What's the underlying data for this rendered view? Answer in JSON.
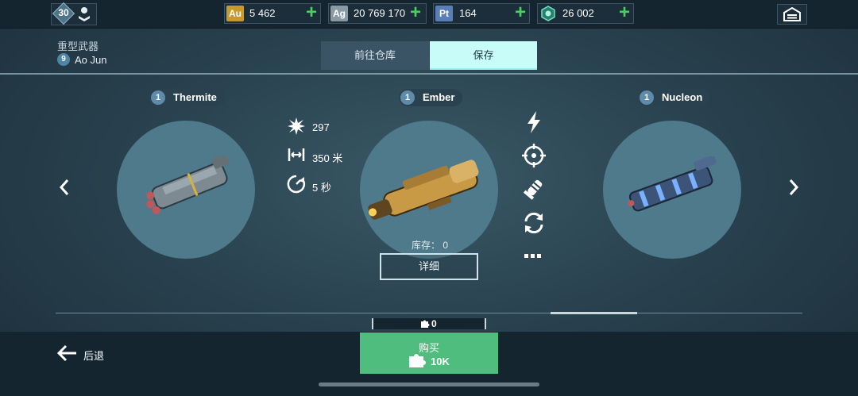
{
  "topbar": {
    "level": "30",
    "resources": [
      {
        "badge": "Au",
        "value": "5 462",
        "badge_color": "#c89a2a"
      },
      {
        "badge": "Ag",
        "value": "20 769 170",
        "badge_color": "#8a9aa4"
      },
      {
        "badge": "Pt",
        "value": "164",
        "badge_color": "#5a7fb8"
      },
      {
        "badge": "",
        "value": "26 002",
        "badge_color": "#3aa68a"
      }
    ]
  },
  "header": {
    "category": "重型武器",
    "pilot_level": "9",
    "pilot_name": "Ao Jun"
  },
  "tabs": {
    "warehouse": "前往仓库",
    "save": "保存"
  },
  "weapons": [
    {
      "level": "1",
      "name": "Thermite"
    },
    {
      "level": "1",
      "name": "Ember"
    },
    {
      "level": "1",
      "name": "Nucleon"
    }
  ],
  "stats": {
    "damage": "297",
    "range": "350 米",
    "reload": "5 秒"
  },
  "stock": "库存： 0",
  "detail_label": "详细",
  "parts_count": "0",
  "back_label": "后退",
  "buy": {
    "label": "购买",
    "price": "10K"
  },
  "colors": {
    "accent_green": "#4fbd7e",
    "plus_green": "#49d15d",
    "tab_active": "#c8fcf8"
  }
}
